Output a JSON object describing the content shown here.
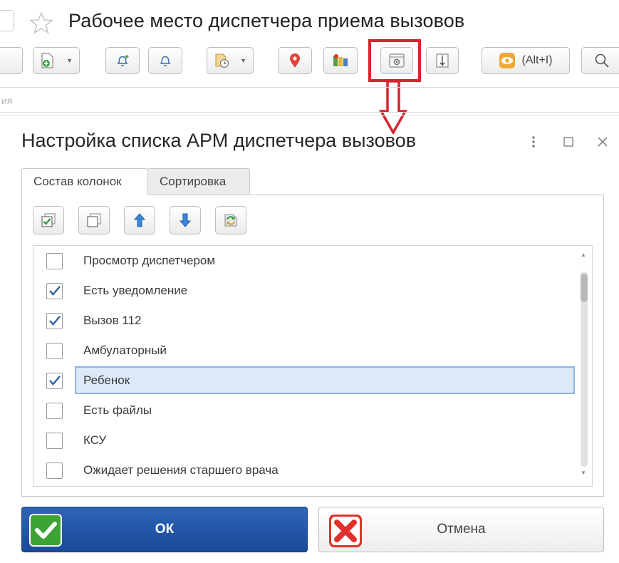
{
  "window": {
    "title": "Рабочее место диспетчера приема вызовов",
    "ghost_text": "ия"
  },
  "toolbar": {
    "buttons": [
      {
        "name": "create-document",
        "icon": "document-plus-icon",
        "dropdown": true
      },
      {
        "name": "bell-add",
        "icon": "bell-plus-icon"
      },
      {
        "name": "bell",
        "icon": "bell-icon"
      },
      {
        "name": "document-history",
        "icon": "document-clock-icon",
        "dropdown": true
      },
      {
        "name": "map-pin",
        "icon": "map-pin-icon"
      },
      {
        "name": "map-layers",
        "icon": "map-icon"
      },
      {
        "name": "list-settings",
        "icon": "list-settings-icon",
        "highlighted": true
      },
      {
        "name": "column-resize",
        "icon": "column-resize-icon"
      },
      {
        "name": "view",
        "icon": "eye-icon"
      },
      {
        "name": "search",
        "icon": "search-icon"
      }
    ],
    "view_shortcut_label": "(Alt+I)",
    "highlight_color": "#d9232e"
  },
  "dialog": {
    "title": "Настройка списка АРМ диспетчера вызовов",
    "tabs": [
      {
        "label": "Состав колонок",
        "active": true
      },
      {
        "label": "Сортировка",
        "active": false
      }
    ],
    "panel_buttons": [
      {
        "name": "check-all",
        "icon": "check-all-icon"
      },
      {
        "name": "uncheck-all",
        "icon": "uncheck-all-icon"
      },
      {
        "name": "move-up",
        "icon": "arrow-up-icon"
      },
      {
        "name": "move-down",
        "icon": "arrow-down-icon"
      },
      {
        "name": "reset-defaults",
        "icon": "reset-icon"
      }
    ],
    "columns": [
      {
        "label": "Просмотр диспетчером",
        "checked": false,
        "selected": false
      },
      {
        "label": "Есть уведомление",
        "checked": true,
        "selected": false
      },
      {
        "label": "Вызов 112",
        "checked": true,
        "selected": false
      },
      {
        "label": "Амбулаторный",
        "checked": false,
        "selected": false
      },
      {
        "label": "Ребенок",
        "checked": true,
        "selected": true
      },
      {
        "label": "Есть файлы",
        "checked": false,
        "selected": false
      },
      {
        "label": "КСУ",
        "checked": false,
        "selected": false
      },
      {
        "label": "Ожидает решения старшего врача",
        "checked": false,
        "selected": false
      }
    ],
    "ok_label": "ОК",
    "cancel_label": "Отмена",
    "colors": {
      "ok_button": "#1f52a6",
      "ok_icon": "#3da335",
      "cancel_icon": "#e0322a",
      "selection_fill": "#dde9f8",
      "selection_border": "#8bb3e2"
    }
  }
}
